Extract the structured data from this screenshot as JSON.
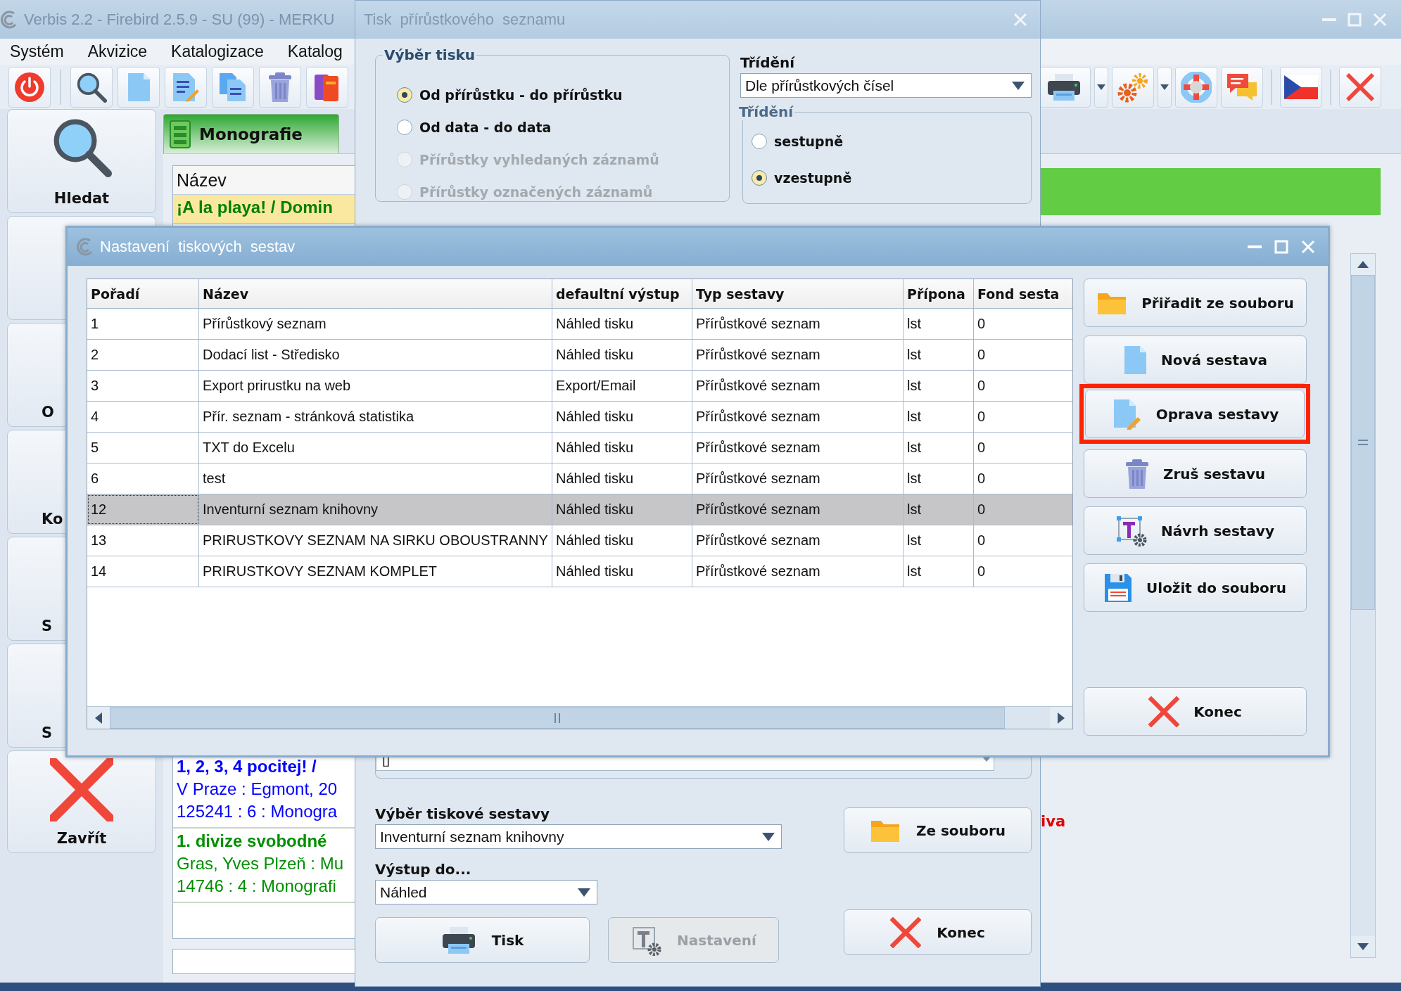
{
  "main_window": {
    "title": "Verbis 2.2 - Firebird 2.5.9 - SU (99) - MERKU",
    "menu": [
      "Systém",
      "Akvizice",
      "Katalogizace",
      "Katalog"
    ],
    "sidebar": {
      "items": [
        {
          "label": "Hledat",
          "kind": "full"
        },
        {
          "kind": "covered"
        },
        {
          "label": "O",
          "kind": "covered"
        },
        {
          "label": "Ko",
          "kind": "covered"
        },
        {
          "label": "S",
          "kind": "covered"
        },
        {
          "label": "S",
          "kind": "covered"
        },
        {
          "label": "Zavřít",
          "kind": "full"
        }
      ]
    },
    "tab": {
      "label": "Monografie",
      "selected": true
    },
    "list": {
      "column": "Název",
      "records": [
        {
          "lines": [
            "¡A la playa! / Domin"
          ],
          "color": "#008000",
          "selected": true
        },
        {
          "lines": [
            "1, 2, 3, 4 pocitej! /",
            "V Praze : Egmont, 20",
            "125241 : 6 : Monogra"
          ],
          "color": "#0000ff",
          "selected": false
        },
        {
          "lines": [
            "1. divize svobodné",
            "Gras, Yves Plzeň : Mu",
            "14746 : 4 : Monografi"
          ],
          "color": "#009000",
          "selected": false
        }
      ]
    },
    "status_text": "iva"
  },
  "print_dialog": {
    "title": "Tisk přírůstkového seznamu",
    "selection_group": {
      "label": "Výběr tisku",
      "options": [
        {
          "label": "Od přírůstku - do přírůstku",
          "selected": true,
          "disabled": false
        },
        {
          "label": "Od data - do data",
          "selected": false,
          "disabled": false
        },
        {
          "label": "Přírůstky vyhledaných záznamů",
          "selected": false,
          "disabled": true
        },
        {
          "label": "Přírůstky označených záznamů",
          "selected": false,
          "disabled": true
        }
      ]
    },
    "sort_label": "Třídění",
    "sort_select": {
      "value": "Dle přírůstkových čísel"
    },
    "order_group": {
      "label": "Třídění",
      "options": [
        {
          "label": "sestupně",
          "selected": false,
          "disabled": false
        },
        {
          "label": "vzestupně",
          "selected": true,
          "disabled": false
        }
      ]
    },
    "condition_field": {
      "value": "[]"
    },
    "report_label": "Výběr tiskové sestavy",
    "report_select": {
      "value": "Inventurní seznam knihovny"
    },
    "output_label": "Výstup do...",
    "output_select": {
      "value": "Náhled"
    },
    "from_file_button": {
      "label": "Ze souboru",
      "disabled": false
    },
    "print_button": {
      "label": "Tisk",
      "disabled": false
    },
    "settings_button": {
      "label": "Nastavení",
      "disabled": true
    },
    "close_button": {
      "label": "Konec",
      "disabled": false
    }
  },
  "settings_dialog": {
    "title": "Nastavení tiskových sestav",
    "table": {
      "columns": [
        "Pořadí",
        "Název",
        "defaultní výstup",
        "Typ sestavy",
        "Přípona",
        "Fond sesta"
      ],
      "rows": [
        {
          "cells": [
            "1",
            "Přírůstkový seznam",
            "Náhled tisku",
            "Přírůstkové seznam",
            "lst",
            "0"
          ],
          "selected": false
        },
        {
          "cells": [
            "2",
            "Dodací list - Středisko",
            "Náhled tisku",
            "Přírůstkové seznam",
            "lst",
            "0"
          ],
          "selected": false
        },
        {
          "cells": [
            "3",
            "Export prirustku na web",
            "Export/Email",
            "Přírůstkové seznam",
            "lst",
            "0"
          ],
          "selected": false
        },
        {
          "cells": [
            "4",
            "Přír. seznam - stránková statistika",
            "Náhled tisku",
            "Přírůstkové seznam",
            "lst",
            "0"
          ],
          "selected": false
        },
        {
          "cells": [
            "5",
            "TXT do Excelu",
            "Náhled tisku",
            "Přírůstkové seznam",
            "lst",
            "0"
          ],
          "selected": false
        },
        {
          "cells": [
            "6",
            "test",
            "Náhled tisku",
            "Přírůstkové seznam",
            "lst",
            "0"
          ],
          "selected": false
        },
        {
          "cells": [
            "12",
            "Inventurní seznam knihovny",
            "Náhled tisku",
            "Přírůstkové seznam",
            "lst",
            "0"
          ],
          "selected": true
        },
        {
          "cells": [
            "13",
            "PRIRUSTKOVY SEZNAM NA SIRKU OBOUSTRANNY",
            "Náhled tisku",
            "Přírůstkové seznam",
            "lst",
            "0"
          ],
          "selected": false
        },
        {
          "cells": [
            "14",
            "PRIRUSTKOVY SEZNAM KOMPLET",
            "Náhled tisku",
            "Přírůstkové seznam",
            "lst",
            "0"
          ],
          "selected": false
        }
      ]
    },
    "buttons": [
      {
        "label": "Přiřadit ze souboru",
        "highlighted": false
      },
      {
        "label": "Nová sestava",
        "highlighted": false
      },
      {
        "label": "Oprava sestavy",
        "highlighted": true
      },
      {
        "label": "Zruš sestavu",
        "highlighted": false
      },
      {
        "label": "Návrh sestavy",
        "highlighted": false
      },
      {
        "label": "Uložit do souboru",
        "highlighted": false
      }
    ],
    "close_button": {
      "label": "Konec"
    }
  }
}
